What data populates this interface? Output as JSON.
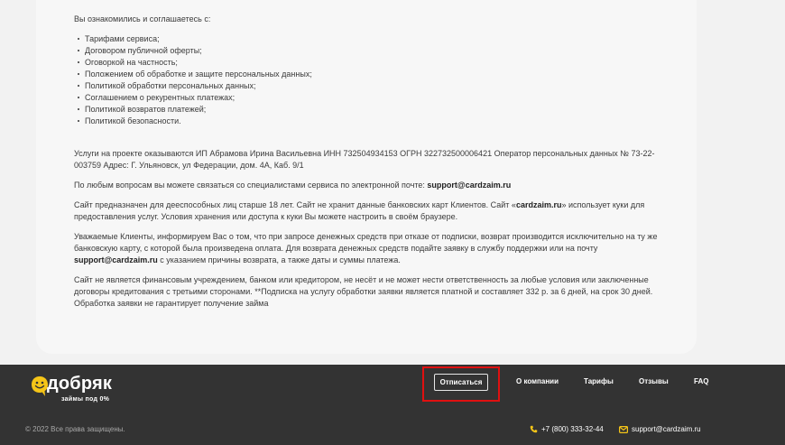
{
  "content": {
    "intro": "Вы ознакомились и соглашаетесь с:",
    "documents": [
      "Тарифами сервиса;",
      "Договором публичной оферты;",
      "Оговоркой на частность;",
      "Положением об обработке и защите персональных данных;",
      "Политикой обработки персональных данных;",
      "Соглашением о рекурентных платежах;",
      "Политикой возвратов платежей;",
      "Политикой безопасности."
    ],
    "services": "Услуги на проекте оказываются ИП Абрамова Ирина Васильевна ИНН 732504934153 ОГРН 322732500006421 Оператор персональных данных № 73-22-003759 Адрес: Г. Ульяновск, ул Федерации, дом. 4А, Каб. 9/1",
    "contact_prefix": "По любым вопросам вы можете связаться со специалистами сервиса по электронной почте: ",
    "contact_email": "support@cardzaim.ru",
    "age_part1": "Сайт предназначен для дееспособных лиц старше 18 лет. Сайт не хранит данные банковских карт Клиентов. Сайт «",
    "age_site": "cardzaim.ru",
    "age_part2": "» использует куки для предоставления услуг. Условия хранения или доступа к куки Вы можете настроить в своём браузере.",
    "refund_part1": "Уважаемые Клиенты, информируем Вас о том, что при запросе денежных средств при отказе от подписки, возврат производится исключительно на ту же банковскую карту, с которой была произведена оплата. Для возврата денежных средств подайте заявку в службу поддержки или на почту ",
    "refund_email": "support@cardzaim.ru",
    "refund_part2": " с указанием причины возврата, а также даты и суммы платежа.",
    "disclaimer": "Сайт не является финансовым учреждением, банком или кредитором, не несёт и не может нести ответственность за любые условия или заключенные договоры кредитования с третьими сторонами. **Подписка на услугу обработки заявки является платной и составляет 332 р. за 6 дней, на срок 30 дней. Обработка заявки не гарантирует получение займа"
  },
  "footer": {
    "logo_text": "добряк",
    "logo_sub": "займы под 0%",
    "unsubscribe": "Отписаться",
    "nav": [
      "О компании",
      "Тарифы",
      "Отзывы",
      "FAQ"
    ],
    "copyright": "© 2022 Все права защищены.",
    "phone": "+7 (800) 333-32-44",
    "email": "support@cardzaim.ru",
    "icons": {
      "logo": "smiley-logo-icon",
      "phone": "phone-icon",
      "email": "envelope-icon"
    },
    "colors": {
      "accent": "#f5c518",
      "footer_bg": "#333333",
      "highlight": "#e01010"
    }
  }
}
